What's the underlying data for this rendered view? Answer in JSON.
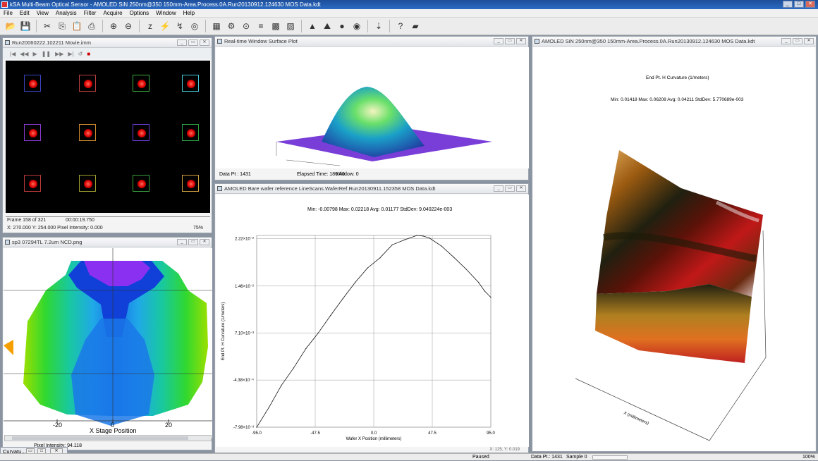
{
  "app": {
    "title": "kSA Multi-Beam Optical Sensor - AMOLED SiN 250nm@350 150mm-Area.Process.0A.Run20130912.124630 MOS Data.kdt"
  },
  "menu": [
    "File",
    "Edit",
    "View",
    "Analysis",
    "Filter",
    "Acquire",
    "Options",
    "Window",
    "Help"
  ],
  "toolbar_icons": [
    "open-icon",
    "save-icon",
    "cut-icon",
    "copy-icon",
    "paste-icon",
    "print-icon",
    "zoom-in-icon",
    "zoom-out-icon",
    "sleep-icon",
    "wand-icon",
    "laser-icon",
    "target-icon",
    "grid-icon",
    "settings-icon",
    "wafer-icon",
    "layers-icon",
    "checker-icon",
    "pattern-icon",
    "stage-icon",
    "mountain-icon",
    "sphere-icon",
    "circle-icon",
    "import-icon",
    "help-icon",
    "book-icon"
  ],
  "movie": {
    "title": "Run20060222.102211 Movie.imm",
    "frame": "Frame 158 of 321",
    "time": "00:00:19.750",
    "pos": "X: 270.000  Y: 254.000  Pixel Intensity: 0.000",
    "zoom": "75%",
    "spot_box_colors": [
      "#3a44c0",
      "#c04040",
      "#3ea83e",
      "#46c8d6",
      "#8a3ad0",
      "#d08a30",
      "#6a3ad0",
      "#2e9e40",
      "#c03a3a",
      "#a0a030",
      "#3aa040",
      "#d0a040"
    ]
  },
  "contour": {
    "title": "sp3 07294TL 7.2um NCD.png",
    "xlabel": "X Stage Position",
    "ticks": [
      "-20",
      "0",
      "20"
    ],
    "status": "Pixel Intensity: 94.118"
  },
  "surface": {
    "title": "Real-time Window Surface Plot",
    "data_pt": "Data Pt : 1431",
    "elapsed": "Elapsed Time: 186.40",
    "window": "Window: 0"
  },
  "line": {
    "title": "AMOLED Bare wafer reference LineScans.WaferRef.Run20130911.152358 MOS Data.kdt",
    "stats": "Min: -0.00798   Max: 0.02218   Avg: 0.01177   StdDev: 9.040224e-003",
    "ylabel": "End Pt. H Curvature (1/meters)",
    "xlabel": "Wafer X Position (millimeters)",
    "ytick_labels": [
      "2.22×10⁻²",
      "1.46×10⁻²",
      "7.10×10⁻³",
      "-4.38×10⁻⁴",
      "-7.98×10⁻³"
    ],
    "xtick_labels": [
      "-95.0",
      "-47.5",
      "0.0",
      "47.5",
      "95.0"
    ],
    "status": "X: 125, Y: 0.019",
    "chart_data": {
      "type": "line",
      "xlabel": "Wafer X Position (millimeters)",
      "ylabel": "End Pt. H Curvature (1/meters)",
      "xlim": [
        -95,
        95
      ],
      "ylim": [
        -0.00798,
        0.0227
      ],
      "x": [
        -95,
        -85,
        -75,
        -65,
        -55,
        -45,
        -35,
        -25,
        -15,
        -5,
        5,
        15,
        25,
        35,
        40,
        45,
        55,
        65,
        75,
        85,
        90,
        95
      ],
      "y": [
        -0.008,
        -0.0048,
        -0.0013,
        0.0015,
        0.0046,
        0.0071,
        0.0099,
        0.0126,
        0.0152,
        0.0175,
        0.0191,
        0.0212,
        0.022,
        0.0227,
        0.0226,
        0.0223,
        0.021,
        0.0192,
        0.0173,
        0.0152,
        0.0138,
        0.0128
      ]
    }
  },
  "view3d": {
    "title": "AMOLED SiN 250nm@350 150mm-Area.Process.0A.Run20130912.124630 MOS Data.kdt",
    "header": "End Pt. H Curvature (1/meters)",
    "stats": "Min: 0.01418   Max: 0.06208   Avg: 0.04211   StdDev: 5.770689e-003",
    "axis_x": "X (millimeters)"
  },
  "taskbar": {
    "label": "Curvatu..."
  },
  "status": {
    "paused": "Paused",
    "data_pt": "Data Pt.: 1431",
    "sample": "Sample 0",
    "zoom": "100%"
  }
}
